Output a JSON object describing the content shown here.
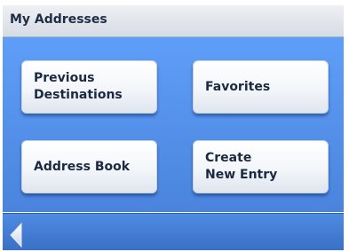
{
  "header": {
    "title": "My Addresses"
  },
  "menu": {
    "previous_destinations": {
      "line1": "Previous",
      "line2": "Destinations"
    },
    "favorites": {
      "label": "Favorites"
    },
    "address_book": {
      "label": "Address Book"
    },
    "create_new_entry": {
      "line1": "Create",
      "line2": "New Entry"
    }
  },
  "footer": {
    "back_icon": "back-arrow-icon"
  },
  "colors": {
    "content_background": "#5f9ef8",
    "button_face": "#ffffff",
    "text": "#1a2a40"
  }
}
